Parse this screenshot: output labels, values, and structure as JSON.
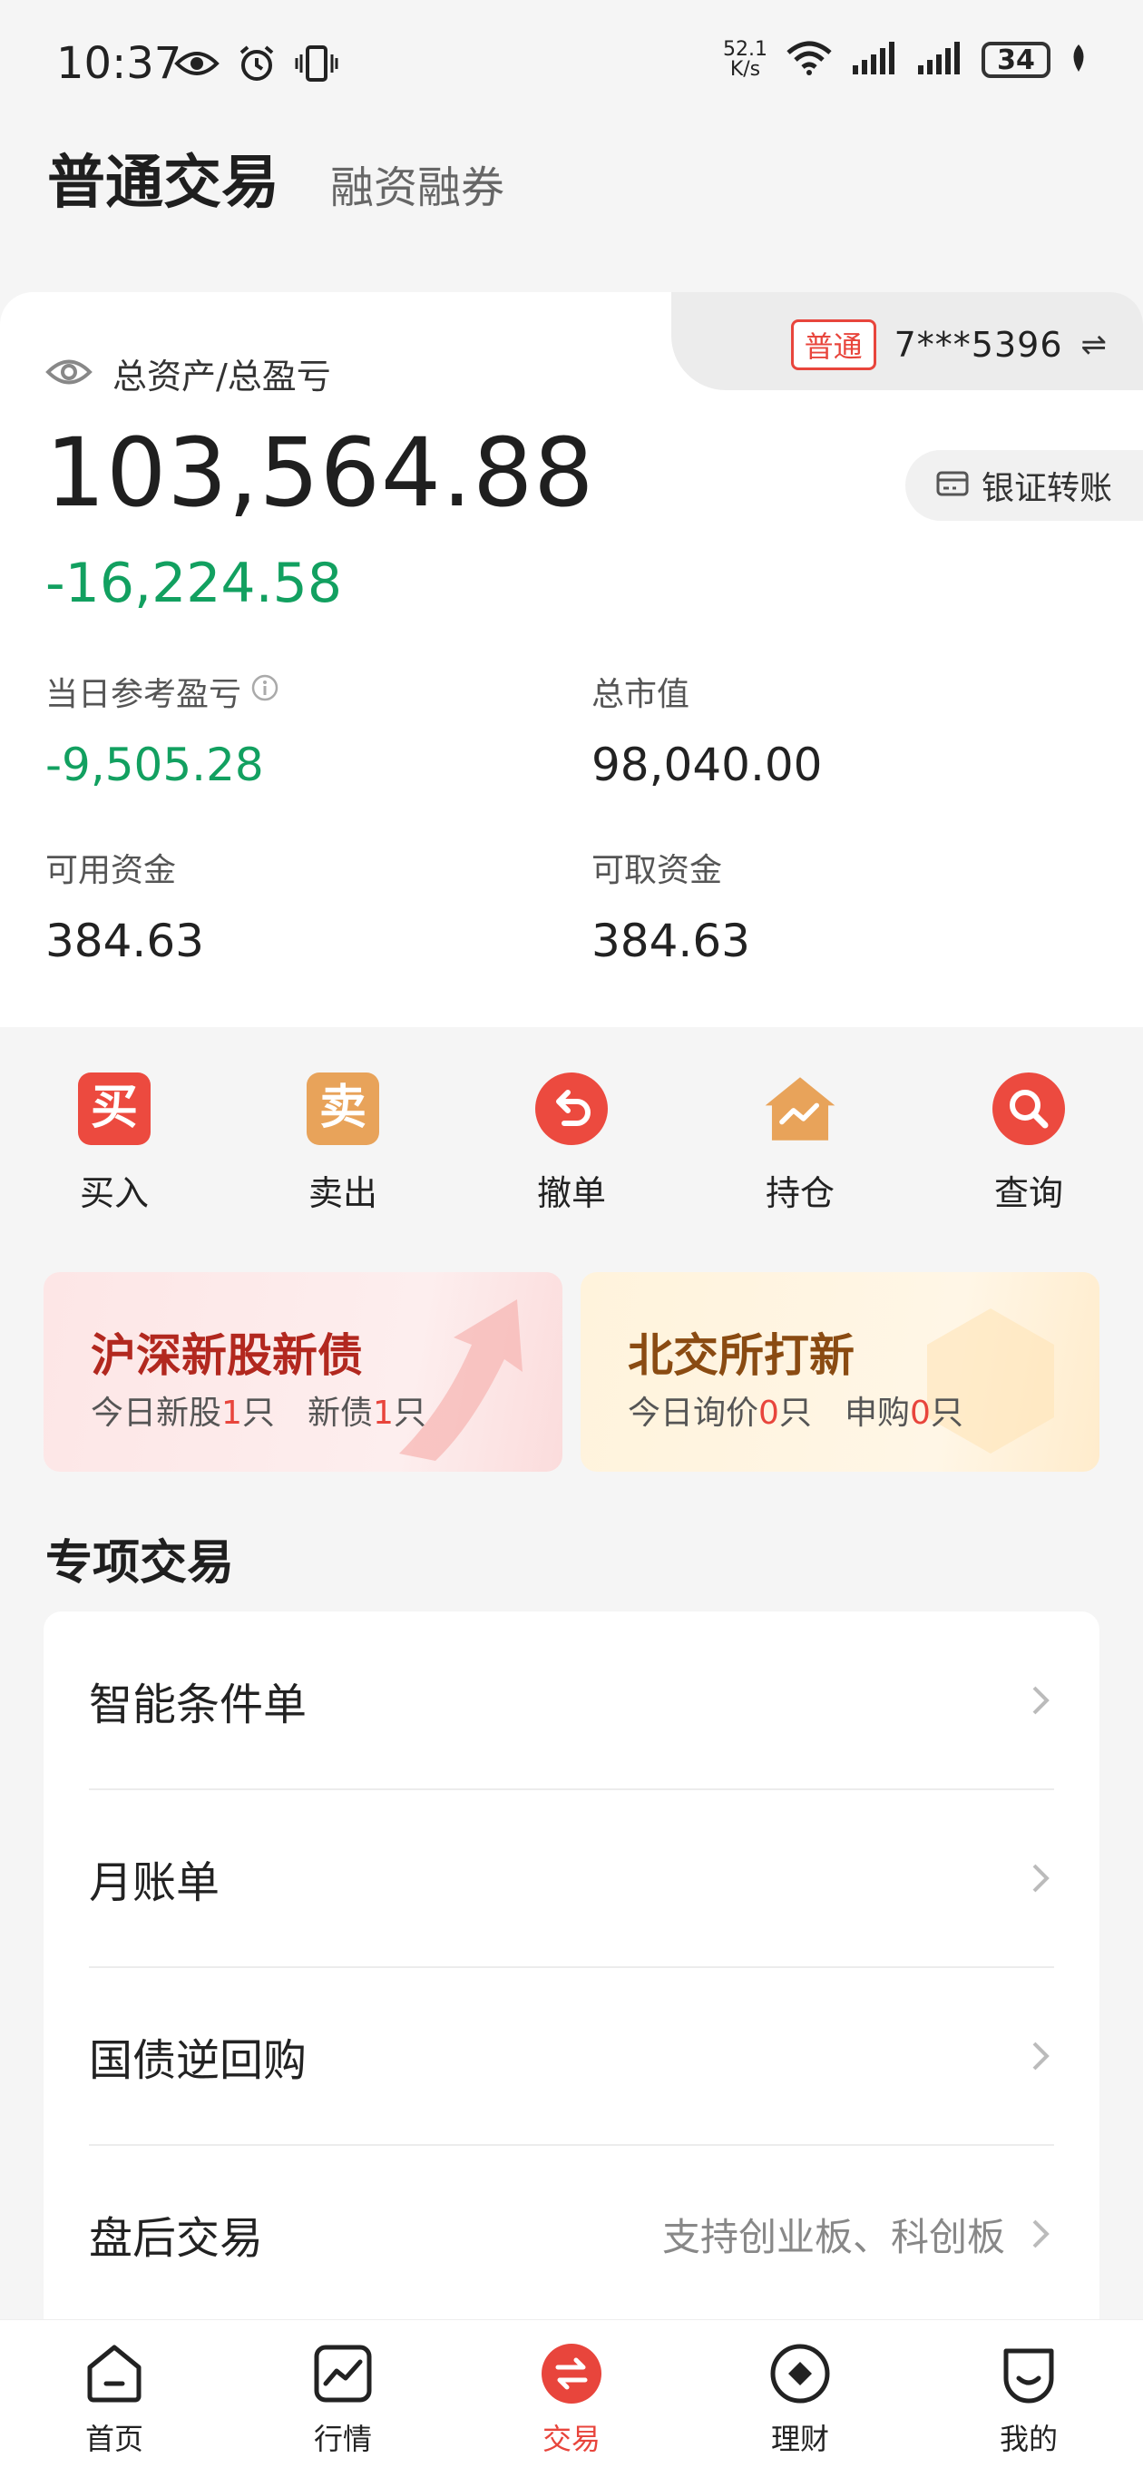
{
  "status_bar": {
    "time": "10:37",
    "speed_value": "52.1",
    "speed_unit": "K/s",
    "battery": "34",
    "icons": [
      "eye-icon",
      "alarm-icon",
      "vibrate-icon",
      "wifi-icon",
      "signal-icon",
      "signal-icon",
      "battery-icon",
      "leaf-icon"
    ]
  },
  "header": {
    "tab_active": "普通交易",
    "tab_inactive": "融资融券"
  },
  "account": {
    "badge": "普通",
    "number": "7***5396",
    "swap_symbol": "⇌"
  },
  "assets": {
    "label": "总资产/总盈亏",
    "total": "103,564.88",
    "total_pl": "-16,224.58",
    "transfer_label": "银证转账",
    "daily_pl_label": "当日参考盈亏",
    "daily_pl": "-9,505.28",
    "market_value_label": "总市值",
    "market_value": "98,040.00",
    "available_label": "可用资金",
    "available": "384.63",
    "withdrawable_label": "可取资金",
    "withdrawable": "384.63"
  },
  "quick_actions": [
    {
      "label": "买入",
      "glyph": "买",
      "color": "#ec4a3f"
    },
    {
      "label": "卖出",
      "glyph": "卖",
      "color": "#e8a35a"
    },
    {
      "label": "撤单",
      "glyph": "",
      "color": "#ec4a3f"
    },
    {
      "label": "持仓",
      "glyph": "",
      "color": "#e8a35a"
    },
    {
      "label": "查询",
      "glyph": "",
      "color": "#ec4a3f"
    }
  ],
  "banners": {
    "left": {
      "title": "沪深新股新债",
      "stock_prefix": "今日新股",
      "stock_count": "1",
      "stock_suffix": "只",
      "bond_prefix": "新债",
      "bond_count": "1",
      "bond_suffix": "只"
    },
    "right": {
      "title": "北交所打新",
      "inquiry_prefix": "今日询价",
      "inquiry_count": "0",
      "inquiry_suffix": "只",
      "subscribe_prefix": "申购",
      "subscribe_count": "0",
      "subscribe_suffix": "只"
    }
  },
  "special": {
    "title": "专项交易",
    "items": [
      {
        "label": "智能条件单",
        "note": ""
      },
      {
        "label": "月账单",
        "note": ""
      },
      {
        "label": "国债逆回购",
        "note": ""
      },
      {
        "label": "盘后交易",
        "note": "支持创业板、科创板"
      }
    ]
  },
  "bottom_nav": [
    {
      "label": "首页",
      "icon": "home-icon"
    },
    {
      "label": "行情",
      "icon": "chart-icon"
    },
    {
      "label": "交易",
      "icon": "trade-icon",
      "active": true
    },
    {
      "label": "理财",
      "icon": "finance-icon"
    },
    {
      "label": "我的",
      "icon": "profile-icon"
    }
  ],
  "colors": {
    "accent_red": "#e8453c",
    "loss_green": "#12a060",
    "gold": "#e8a35a"
  }
}
